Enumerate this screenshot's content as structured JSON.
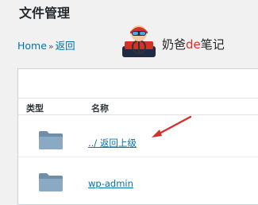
{
  "page": {
    "title": "文件管理"
  },
  "breadcrumb": {
    "home": "Home",
    "separator": "»",
    "back": "返回"
  },
  "watermark": {
    "text_prefix": "奶爸",
    "text_accent": "de",
    "text_suffix": "笔记"
  },
  "table": {
    "columns": {
      "type": "类型",
      "name": "名称"
    },
    "rows": [
      {
        "icon": "folder-icon",
        "name": "../ 返回上级"
      },
      {
        "icon": "folder-icon",
        "name": "wp-admin"
      }
    ]
  },
  "colors": {
    "link": "#0073aa",
    "accent": "#d7302b",
    "arrow": "#d7302b"
  }
}
